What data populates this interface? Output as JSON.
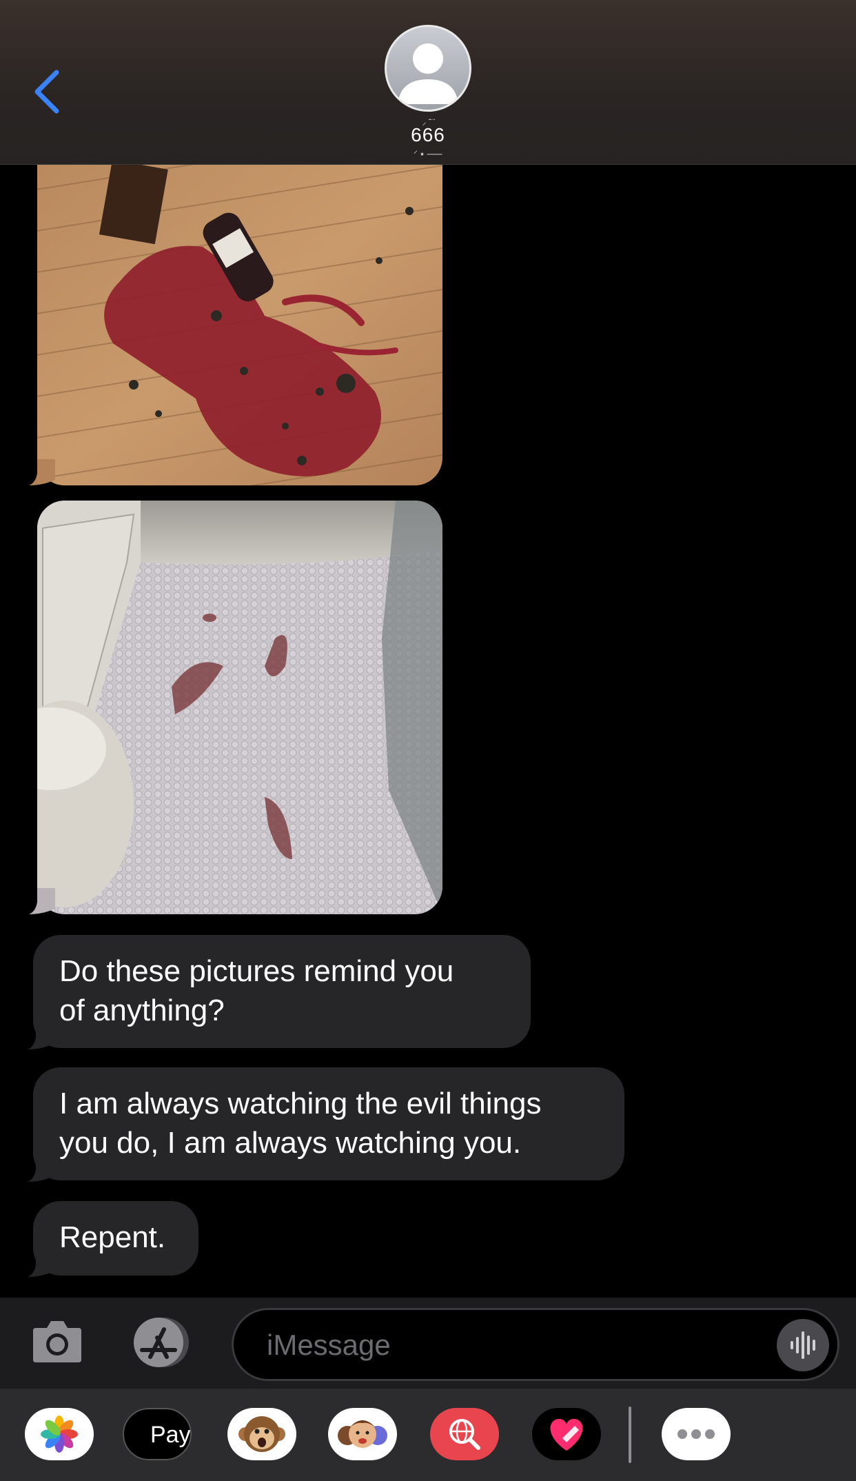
{
  "header": {
    "back_icon": "chevron-left-icon",
    "contact_name": "666",
    "avatar_icon": "person-placeholder-icon",
    "accent_color": "#3b82f6"
  },
  "messages": [
    {
      "type": "image",
      "description_icon": "photo"
    },
    {
      "type": "image",
      "description_icon": "photo"
    },
    {
      "type": "text",
      "text_line1": "Do these pictures remind you",
      "text_line2": "of anything?"
    },
    {
      "type": "text",
      "text_line1": "I am always watching the evil things",
      "text_line2": "you do, I am always watching you."
    },
    {
      "type": "text",
      "text_line1": "Repent."
    }
  ],
  "input": {
    "placeholder": "iMessage",
    "camera_icon": "camera-icon",
    "apps_icon": "app-store-icon",
    "voice_icon": "waveform-icon"
  },
  "drawer": {
    "apple_pay_label": "Pay",
    "apps": [
      "photos-icon",
      "apple-pay-icon",
      "animoji-icon",
      "memoji-icon",
      "image-search-icon",
      "digital-touch-icon",
      "more-icon"
    ]
  }
}
